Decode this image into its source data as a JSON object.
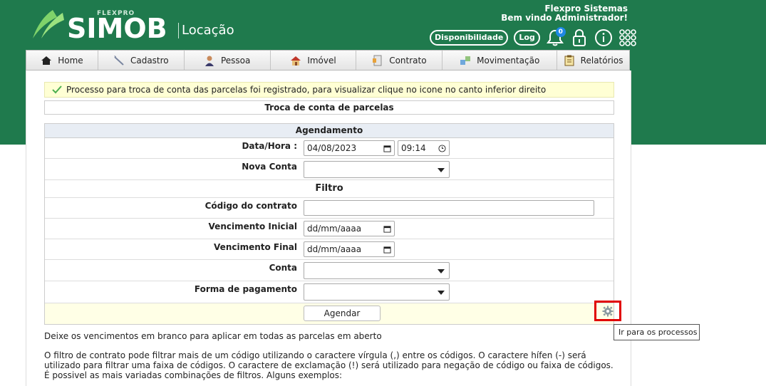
{
  "header": {
    "logo_sup": "FLEXPRO",
    "logo_text": "SIMOB",
    "logo_sub": "Locação",
    "company": "Flexpro Sistemas",
    "welcome": "Bem vindo Administrador!",
    "disponibilidade_label": "Disponibilidade",
    "log_label": "Log",
    "notifications_count": "0"
  },
  "nav": {
    "items": [
      {
        "label": "Home",
        "icon": "home-icon"
      },
      {
        "label": "Cadastro",
        "icon": "pencil-icon"
      },
      {
        "label": "Pessoa",
        "icon": "person-icon"
      },
      {
        "label": "Imóvel",
        "icon": "house-icon"
      },
      {
        "label": "Contrato",
        "icon": "contract-icon"
      },
      {
        "label": "Movimentação",
        "icon": "transfer-icon"
      },
      {
        "label": "Relatórios",
        "icon": "report-icon"
      }
    ]
  },
  "alert": {
    "text": "Processo para troca de conta das parcelas foi registrado, para visualizar clique no icone no canto inferior direito"
  },
  "page_title": "Troca de conta de parcelas",
  "form": {
    "agendamento_head": "Agendamento",
    "datahora_label": "Data/Hora :",
    "date_value": "04/08/2023",
    "time_value": "09:14",
    "nova_conta_label": "Nova Conta",
    "filtro_head": "Filtro",
    "codigo_label": "Código do contrato",
    "venc_inicial_label": "Vencimento Inicial",
    "venc_inicial_placeholder": "dd/mm/aaaa",
    "venc_final_label": "Vencimento Final",
    "venc_final_placeholder": "dd/mm/aaaa",
    "conta_label": "Conta",
    "forma_label": "Forma de pagamento",
    "agendar_label": "Agendar"
  },
  "tooltip": "Ir para os processos",
  "notes": {
    "note1": "Deixe os vencimentos em branco para aplicar em todas as parcelas em aberto",
    "note2": "O filtro de contrato pode filtrar mais de um código utilizando o caractere vírgula (,) entre os códigos. O caractere hífen (-) será utilizado para filtrar uma faixa de códigos. O caractere de exclamação (!) será utilizado para negação de código ou faixa de códigos. É possivel as mais variadas combinações de filtros. Alguns exemplos:"
  },
  "colors": {
    "brand_green": "#1f7a4d",
    "alert_bg": "#ffffd4",
    "highlight_red": "#e10000"
  }
}
